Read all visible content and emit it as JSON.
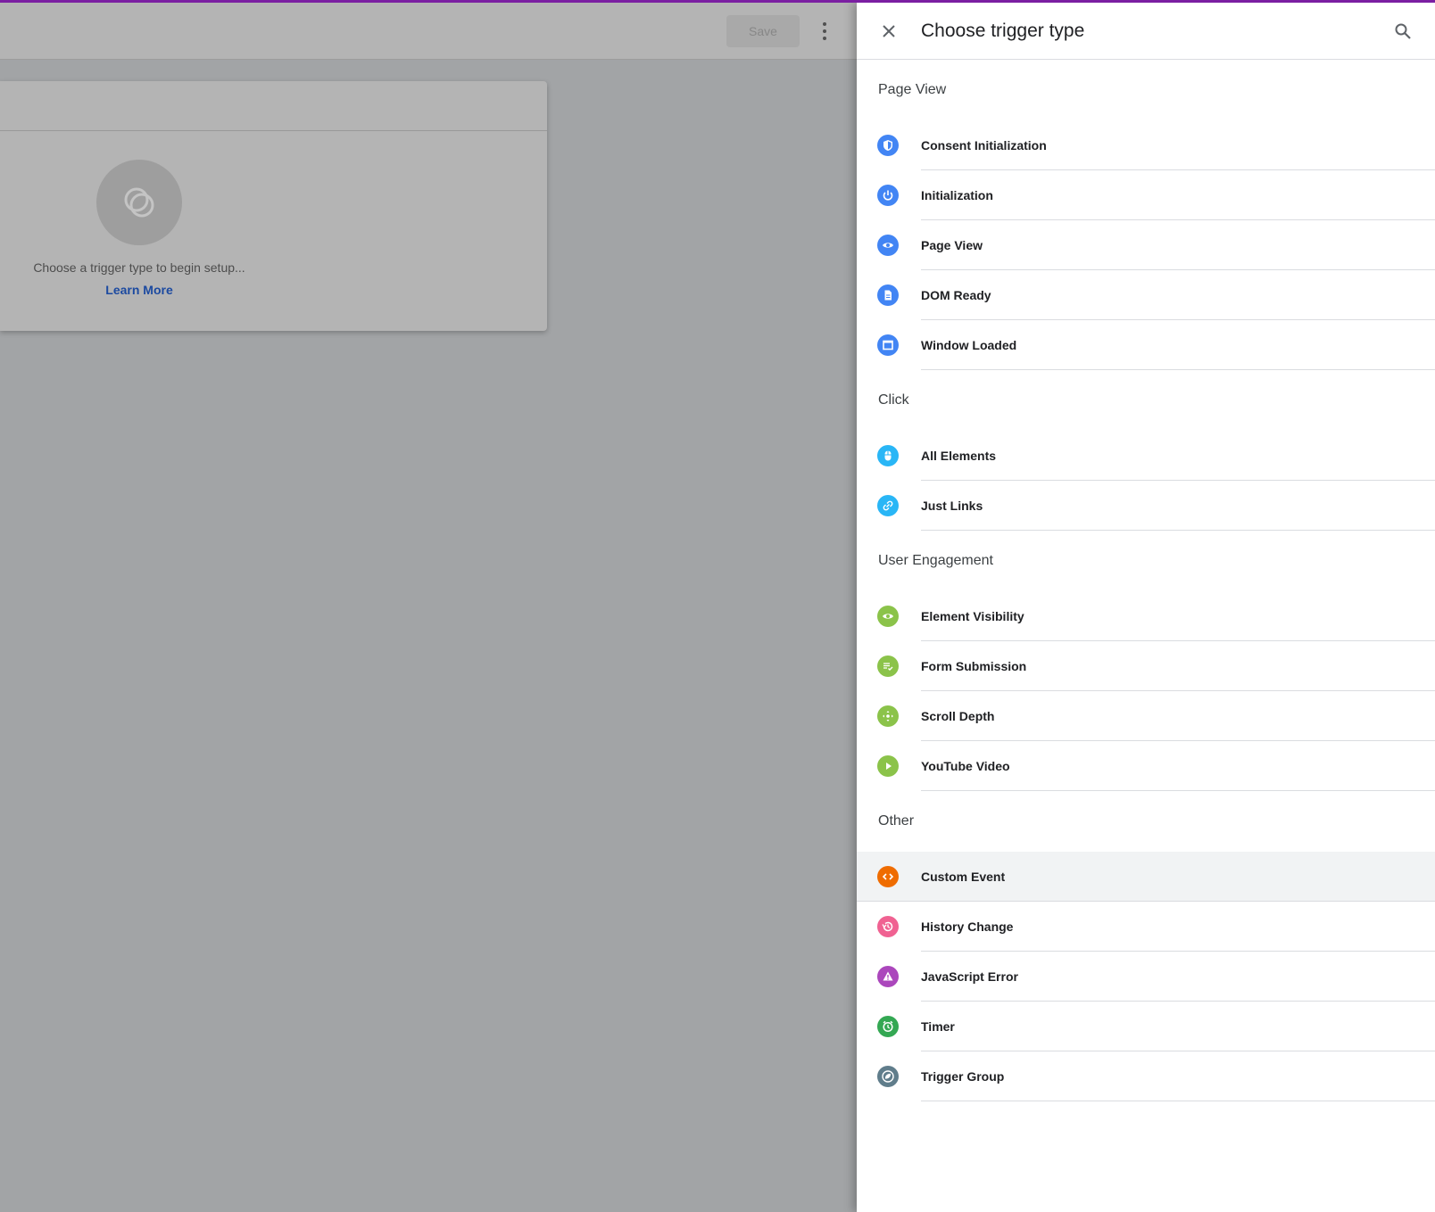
{
  "background": {
    "save_label": "Save",
    "card_text": "Choose a trigger type to begin setup...",
    "learn_more": "Learn More"
  },
  "panel": {
    "title": "Choose trigger type",
    "sections": [
      {
        "title": "Page View",
        "items": [
          {
            "label": "Consent Initialization",
            "icon": "shield-icon",
            "color": "#4285f4"
          },
          {
            "label": "Initialization",
            "icon": "power-icon",
            "color": "#4285f4"
          },
          {
            "label": "Page View",
            "icon": "eye-icon",
            "color": "#4285f4"
          },
          {
            "label": "DOM Ready",
            "icon": "document-icon",
            "color": "#4285f4"
          },
          {
            "label": "Window Loaded",
            "icon": "window-icon",
            "color": "#4285f4"
          }
        ]
      },
      {
        "title": "Click",
        "items": [
          {
            "label": "All Elements",
            "icon": "mouse-icon",
            "color": "#29b6f6"
          },
          {
            "label": "Just Links",
            "icon": "link-icon",
            "color": "#29b6f6"
          }
        ]
      },
      {
        "title": "User Engagement",
        "items": [
          {
            "label": "Element Visibility",
            "icon": "eye-icon",
            "color": "#8bc34a"
          },
          {
            "label": "Form Submission",
            "icon": "form-check-icon",
            "color": "#8bc34a"
          },
          {
            "label": "Scroll Depth",
            "icon": "scroll-icon",
            "color": "#8bc34a"
          },
          {
            "label": "YouTube Video",
            "icon": "play-icon",
            "color": "#8bc34a"
          }
        ]
      },
      {
        "title": "Other",
        "items": [
          {
            "label": "Custom Event",
            "icon": "code-icon",
            "color": "#ef6c00"
          },
          {
            "label": "History Change",
            "icon": "history-icon",
            "color": "#f06292"
          },
          {
            "label": "JavaScript Error",
            "icon": "warning-icon",
            "color": "#ab47bc"
          },
          {
            "label": "Timer",
            "icon": "alarm-icon",
            "color": "#34a853"
          },
          {
            "label": "Trigger Group",
            "icon": "trigger-group-icon",
            "color": "#607d8b"
          }
        ]
      }
    ]
  }
}
